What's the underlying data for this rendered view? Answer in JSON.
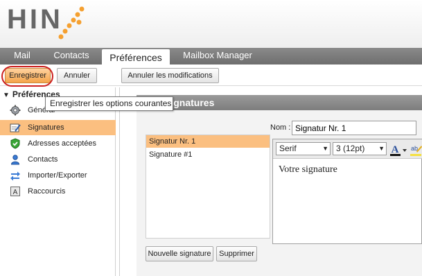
{
  "brand": {
    "logo_text": "HIN",
    "dot_color": "#f5a030"
  },
  "tabs": [
    {
      "label": "Mail",
      "active": false
    },
    {
      "label": "Contacts",
      "active": false
    },
    {
      "label": "Préférences",
      "active": true
    },
    {
      "label": "Mailbox Manager",
      "active": false
    }
  ],
  "toolbar": {
    "save_label": "Enregistrer",
    "cancel_label": "Annuler",
    "revert_label": "Annuler les modifications"
  },
  "tooltip": {
    "text": "Enregistrer les options courantes"
  },
  "sidebar": {
    "heading": "Préférences",
    "items": [
      {
        "label": "Général",
        "icon": "gear-icon",
        "selected": false
      },
      {
        "label": "Signatures",
        "icon": "signature-icon",
        "selected": true
      },
      {
        "label": "Adresses acceptées",
        "icon": "shield-check-icon",
        "selected": false
      },
      {
        "label": "Contacts",
        "icon": "contact-icon",
        "selected": false
      },
      {
        "label": "Importer/Exporter",
        "icon": "import-export-icon",
        "selected": false
      },
      {
        "label": "Raccourcis",
        "icon": "keyboard-shortcut-icon",
        "selected": false
      }
    ]
  },
  "panel": {
    "title": "Signatures",
    "name_label": "Nom :",
    "name_value": "Signatur Nr. 1",
    "signatures": [
      {
        "label": "Signatur Nr. 1",
        "selected": true
      },
      {
        "label": "Signature #1",
        "selected": false
      }
    ],
    "editor": {
      "font_family": "Serif",
      "font_size": "3 (12pt)",
      "content": "Votre signature"
    },
    "new_label": "Nouvelle signature",
    "delete_label": "Supprimer"
  },
  "colors": {
    "accent": "#fbbf80",
    "highlight_ring": "#cc1f1f",
    "tab_bar": "#7a7a7a"
  }
}
